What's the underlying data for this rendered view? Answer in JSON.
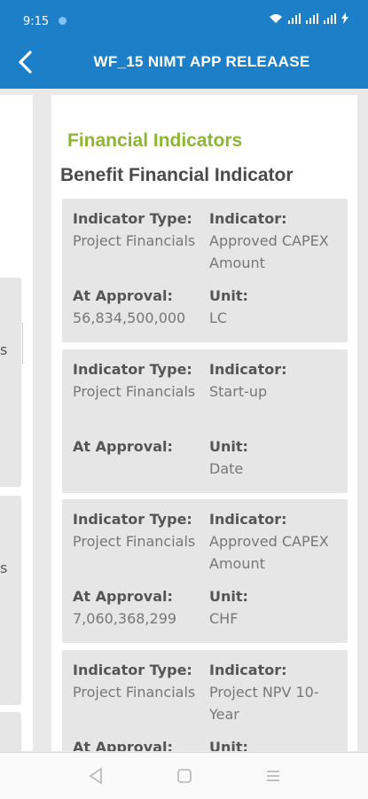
{
  "status_bar": {
    "time": "9:15"
  },
  "app_bar": {
    "title": "WF_15 NIMT APP RELEAASE"
  },
  "left_pane": {
    "peek_chars": [
      "s",
      "s"
    ]
  },
  "main": {
    "section_title": "Financial Indicators",
    "sub_title": "Benefit Financial Indicator",
    "cards": [
      {
        "type_label": "Indicator Type:",
        "type_value": "Project Financials",
        "indicator_label": "Indicator:",
        "indicator_value": "Approved CAPEX Amount",
        "approval_label": "At Approval:",
        "approval_value": "56,834,500,000",
        "unit_label": "Unit:",
        "unit_value": "LC"
      },
      {
        "type_label": "Indicator Type:",
        "type_value": "Project Financials",
        "indicator_label": "Indicator:",
        "indicator_value": "Start-up",
        "approval_label": "At Approval:",
        "approval_value": "",
        "unit_label": "Unit:",
        "unit_value": "Date"
      },
      {
        "type_label": "Indicator Type:",
        "type_value": "Project Financials",
        "indicator_label": "Indicator:",
        "indicator_value": "Approved CAPEX Amount",
        "approval_label": "At Approval:",
        "approval_value": "7,060,368,299",
        "unit_label": "Unit:",
        "unit_value": "CHF"
      },
      {
        "type_label": "Indicator Type:",
        "type_value": "Project Financials",
        "indicator_label": "Indicator:",
        "indicator_value": "Project NPV 10-Year",
        "approval_label": "At Approval:",
        "approval_value": "",
        "unit_label": "Unit:",
        "unit_value": ""
      }
    ]
  },
  "colors": {
    "brand": "#1d7fc8",
    "accent": "#8db633",
    "card": "#e6e6e6"
  },
  "icons": {
    "back": "chevron-left-icon",
    "check": "check-icon",
    "nav_back": "triangle-back-icon",
    "nav_home": "square-home-icon",
    "nav_recents": "menu-lines-icon"
  }
}
